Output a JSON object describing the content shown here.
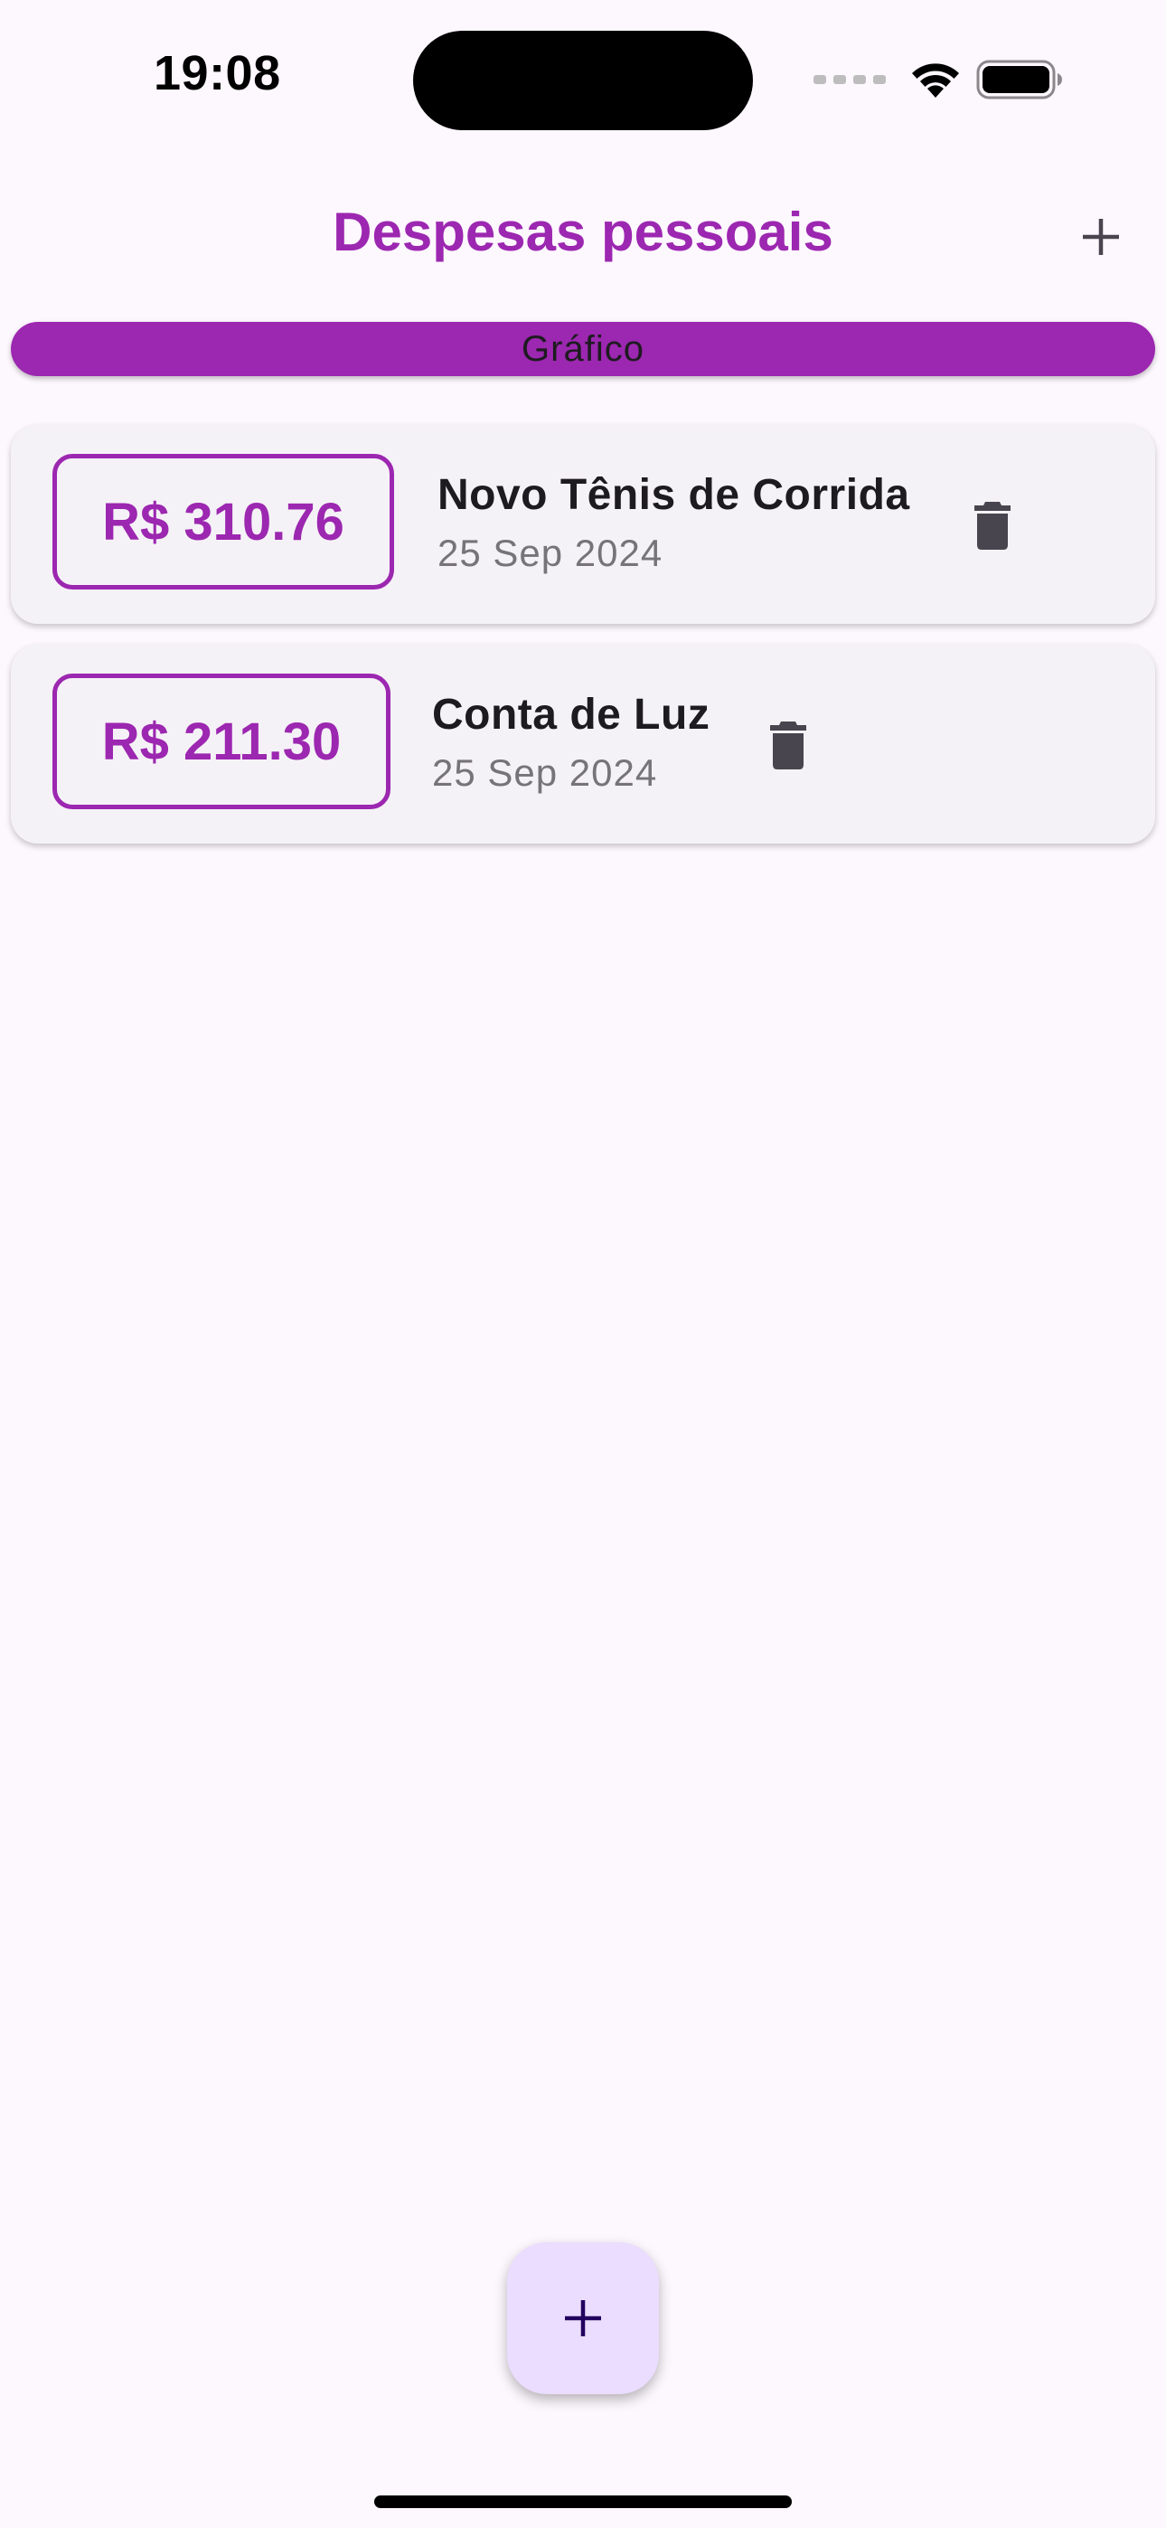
{
  "status_bar": {
    "time": "19:08",
    "icons": [
      "cellular-signal-icon",
      "wifi-icon",
      "battery-icon"
    ]
  },
  "app_bar": {
    "title": "Despesas pessoais",
    "add_icon": "plus-icon"
  },
  "chart_button": {
    "label": "Gráfico"
  },
  "transactions": [
    {
      "amount": "R$ 310.76",
      "title": "Novo Tênis de Corrida",
      "date": "25 Sep 2024",
      "delete_icon": "trash-icon"
    },
    {
      "amount": "R$ 211.30",
      "title": "Conta de Luz",
      "date": "25 Sep 2024",
      "delete_icon": "trash-icon"
    }
  ],
  "fab": {
    "icon": "plus-icon"
  },
  "colors": {
    "primary": "#9c27b0",
    "background": "#fdf7fe",
    "card": "#f5f2f7",
    "fab": "#eaddff",
    "text": "#1d1b20",
    "muted": "#76737a"
  }
}
